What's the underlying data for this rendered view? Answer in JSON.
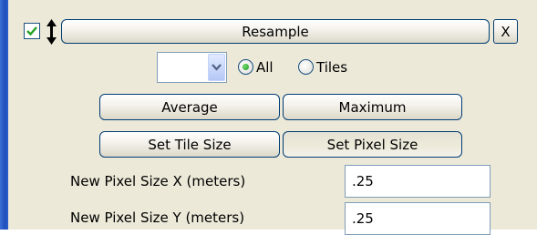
{
  "panel": {
    "enabled_checked": true,
    "title_button": "Resample",
    "close_button": "X"
  },
  "selection": {
    "dropdown_value": "",
    "options": [
      {
        "label": "All",
        "selected": true
      },
      {
        "label": "Tiles",
        "selected": false
      }
    ]
  },
  "method_buttons": {
    "average": "Average",
    "maximum": "Maximum"
  },
  "size_buttons": {
    "set_tile_size": "Set Tile Size",
    "set_pixel_size": "Set Pixel Size"
  },
  "fields": {
    "pixel_size_x": {
      "label": "New Pixel Size X (meters)",
      "value": ".25"
    },
    "pixel_size_y": {
      "label": "New Pixel Size Y (meters)",
      "value": ".25"
    }
  },
  "colors": {
    "window_accent": "#2b5fcc",
    "panel_bg": "#ece9d8",
    "check_green": "#21a121",
    "radio_green": "#1f8f1f"
  }
}
